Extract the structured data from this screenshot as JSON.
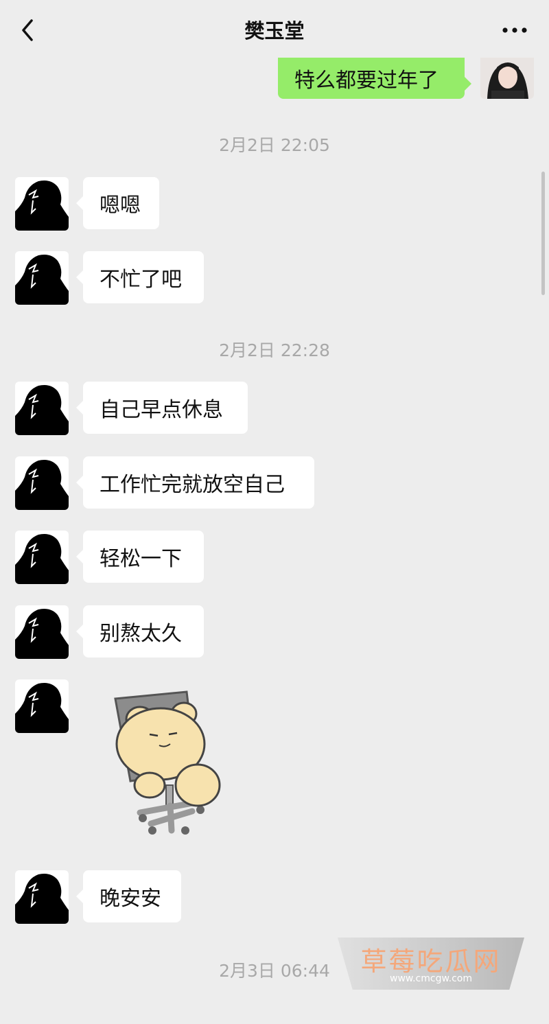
{
  "header": {
    "title": "樊玉堂",
    "back_icon": "chevron-left-icon",
    "more_icon": "more-dots-icon"
  },
  "messages": {
    "sent_1": "特么都要过年了",
    "time_1": "2月2日 22:05",
    "recv_1": "嗯嗯",
    "recv_2": "不忙了吧",
    "time_2": "2月2日 22:28",
    "recv_3": "自己早点休息",
    "recv_4": "工作忙完就放空自己",
    "recv_5": "轻松一下",
    "recv_6": "别熬太久",
    "sticker": "bear-on-chair-sticker",
    "recv_7": "晚安安",
    "time_3": "2月3日 06:44"
  },
  "watermark": {
    "name": "草莓吃瓜网",
    "url": "www.cmcgw.com"
  },
  "colors": {
    "background": "#ededed",
    "sent_bubble": "#95ec69",
    "recv_bubble": "#ffffff",
    "timestamp": "#a8a8a8"
  }
}
